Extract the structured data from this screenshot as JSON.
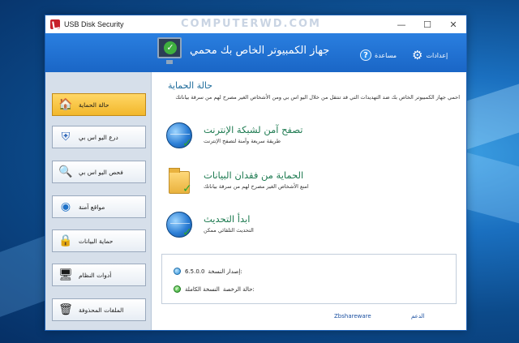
{
  "window": {
    "title": "USB Disk Security",
    "watermark": "COMPUTERWD.COM",
    "controls": {
      "minimize": "—",
      "maximize": "☐",
      "close": "✕"
    }
  },
  "header": {
    "title": "جهاز الكمبيوتر الخاص بك محمي",
    "help_label": "مساعدة",
    "settings_label": "إعدادات"
  },
  "sidebar": {
    "items": [
      {
        "label": "حالة الحماية",
        "icon": "home-icon",
        "active": true
      },
      {
        "label": "درع اليو اس بي",
        "icon": "shield-icon",
        "active": false
      },
      {
        "label": "فحص اليو اس بي",
        "icon": "magnifier-icon",
        "active": false
      },
      {
        "label": "مواقع آمنة",
        "icon": "globe-icon",
        "active": false
      },
      {
        "label": "حماية البيانات",
        "icon": "data-lock-icon",
        "active": false
      },
      {
        "label": "أدوات النظام",
        "icon": "monitor-icon",
        "active": false
      },
      {
        "label": "الملفات المحذوفة",
        "icon": "trash-icon",
        "active": false
      }
    ]
  },
  "main": {
    "section_title": "حالة الحماية",
    "section_desc": "احمي جهاز الكمبيوتر الخاص بك ضد التهديدات التي قد تنتقل من خلال اليو اس بي ومن الأشخاص الغير مصرح لهم من سرقة بياناتك",
    "features": [
      {
        "title": "تصفح آمن لشبكة الإنترنت",
        "subtitle": "طريقة سريعة وآمنة لتصفح الإنترنت",
        "icon": "globe-check-icon"
      },
      {
        "title": "الحماية من فقدان البيانات",
        "subtitle": "امنع الأشخاص الغير مصرح لهم من سرقة بياناتك",
        "icon": "folder-check-icon"
      },
      {
        "title": "ابدأ التحديث",
        "subtitle": "التحديث التلقائي ممكن",
        "icon": "update-globe-icon"
      }
    ],
    "info": {
      "version_key": "إصدار النسخة:",
      "version_value": "6.5.0.0",
      "license_key": "حالة الرخصة:",
      "license_value": "النسخة الكاملة"
    },
    "footer": {
      "vendor_link": "Zbshareware",
      "help_link": "الدعم"
    }
  }
}
